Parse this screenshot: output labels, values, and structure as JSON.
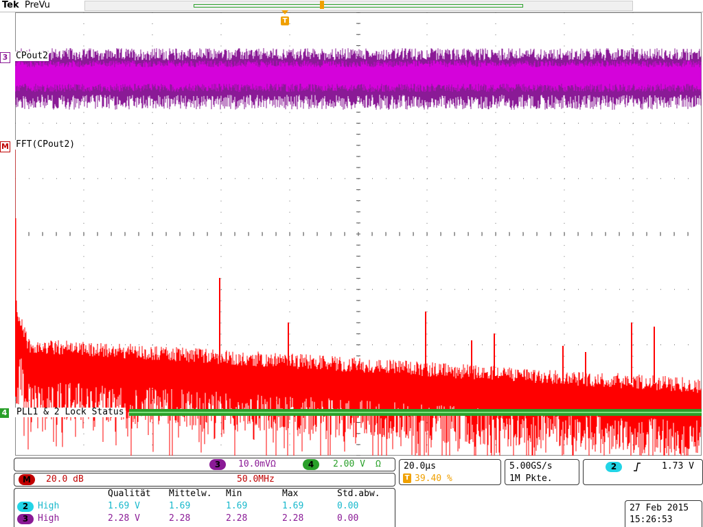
{
  "header": {
    "brand": "Tek",
    "acquisition_state": "PreVu"
  },
  "trigger_marker": "T",
  "channels": {
    "ch3": {
      "number": "3",
      "label": "CPout2",
      "color": "#8a1a96"
    },
    "math": {
      "number": "M",
      "label": "FFT(CPout2)",
      "color": "#c00000"
    },
    "ch4": {
      "number": "4",
      "label": "PLL1 & 2 Lock Status",
      "color": "#2aa02a"
    }
  },
  "vertical_panel": {
    "ch3_badge": "3",
    "ch3_scale": "10.0mVΩ",
    "ch4_badge": "4",
    "ch4_scale": "2.00 V",
    "ch4_termination": "Ω",
    "math_badge": "M",
    "math_scale": "20.0 dB",
    "math_span": "50.0MHz"
  },
  "timebase": {
    "scale": "20.0μs",
    "trigger_badge": "T",
    "trigger_position": "39.40 %"
  },
  "acquisition": {
    "sample_rate": "5.00GS/s",
    "record_length": "1M Pkte."
  },
  "trigger": {
    "source_badge": "2",
    "slope_icon": "rising-edge",
    "level": "1.73 V"
  },
  "measurements": {
    "headers": [
      "Qualität",
      "Mittelw.",
      "Min",
      "Max",
      "Std.abw."
    ],
    "rows": [
      {
        "badge": "2",
        "quality": "High",
        "value": "1.69 V",
        "mean": "1.69",
        "min": "1.69",
        "max": "1.69",
        "std": "0.00",
        "badge_color": "#22d4e6",
        "text_color": "#17b8cc"
      },
      {
        "badge": "3",
        "quality": "High",
        "value": "2.28 V",
        "mean": "2.28",
        "min": "2.28",
        "max": "2.28",
        "std": "0.00",
        "badge_color": "#8a1a96",
        "text_color": "#8a1a96"
      }
    ]
  },
  "datetime": {
    "date": "27 Feb 2015",
    "time": "15:26:53"
  },
  "colors": {
    "ch3": "#8a1a96",
    "ch3_dense": "#e000e6",
    "math": "#ff0000",
    "ch4": "#2aa02a",
    "ch2": "#22d4e6",
    "trigger": "#f0a000"
  }
}
